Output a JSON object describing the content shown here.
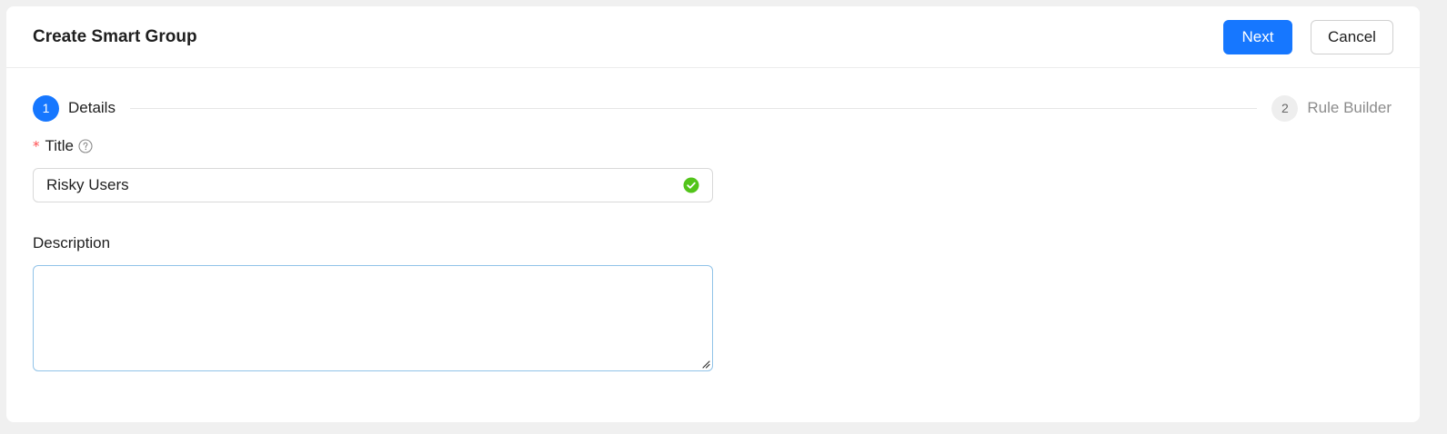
{
  "header": {
    "title": "Create Smart Group",
    "next_label": "Next",
    "cancel_label": "Cancel"
  },
  "steps": [
    {
      "number": "1",
      "label": "Details",
      "state": "active"
    },
    {
      "number": "2",
      "label": "Rule Builder",
      "state": "inactive"
    }
  ],
  "form": {
    "title_label": "Title",
    "title_required_mark": "*",
    "title_value": "Risky Users",
    "title_status": "valid",
    "description_label": "Description",
    "description_value": ""
  },
  "colors": {
    "primary": "#1677ff",
    "success": "#52c41a",
    "required": "#ff4d4f"
  },
  "icons": {
    "help": "question-circle-icon",
    "valid": "check-circle-icon",
    "resize": "resize-handle-icon"
  }
}
